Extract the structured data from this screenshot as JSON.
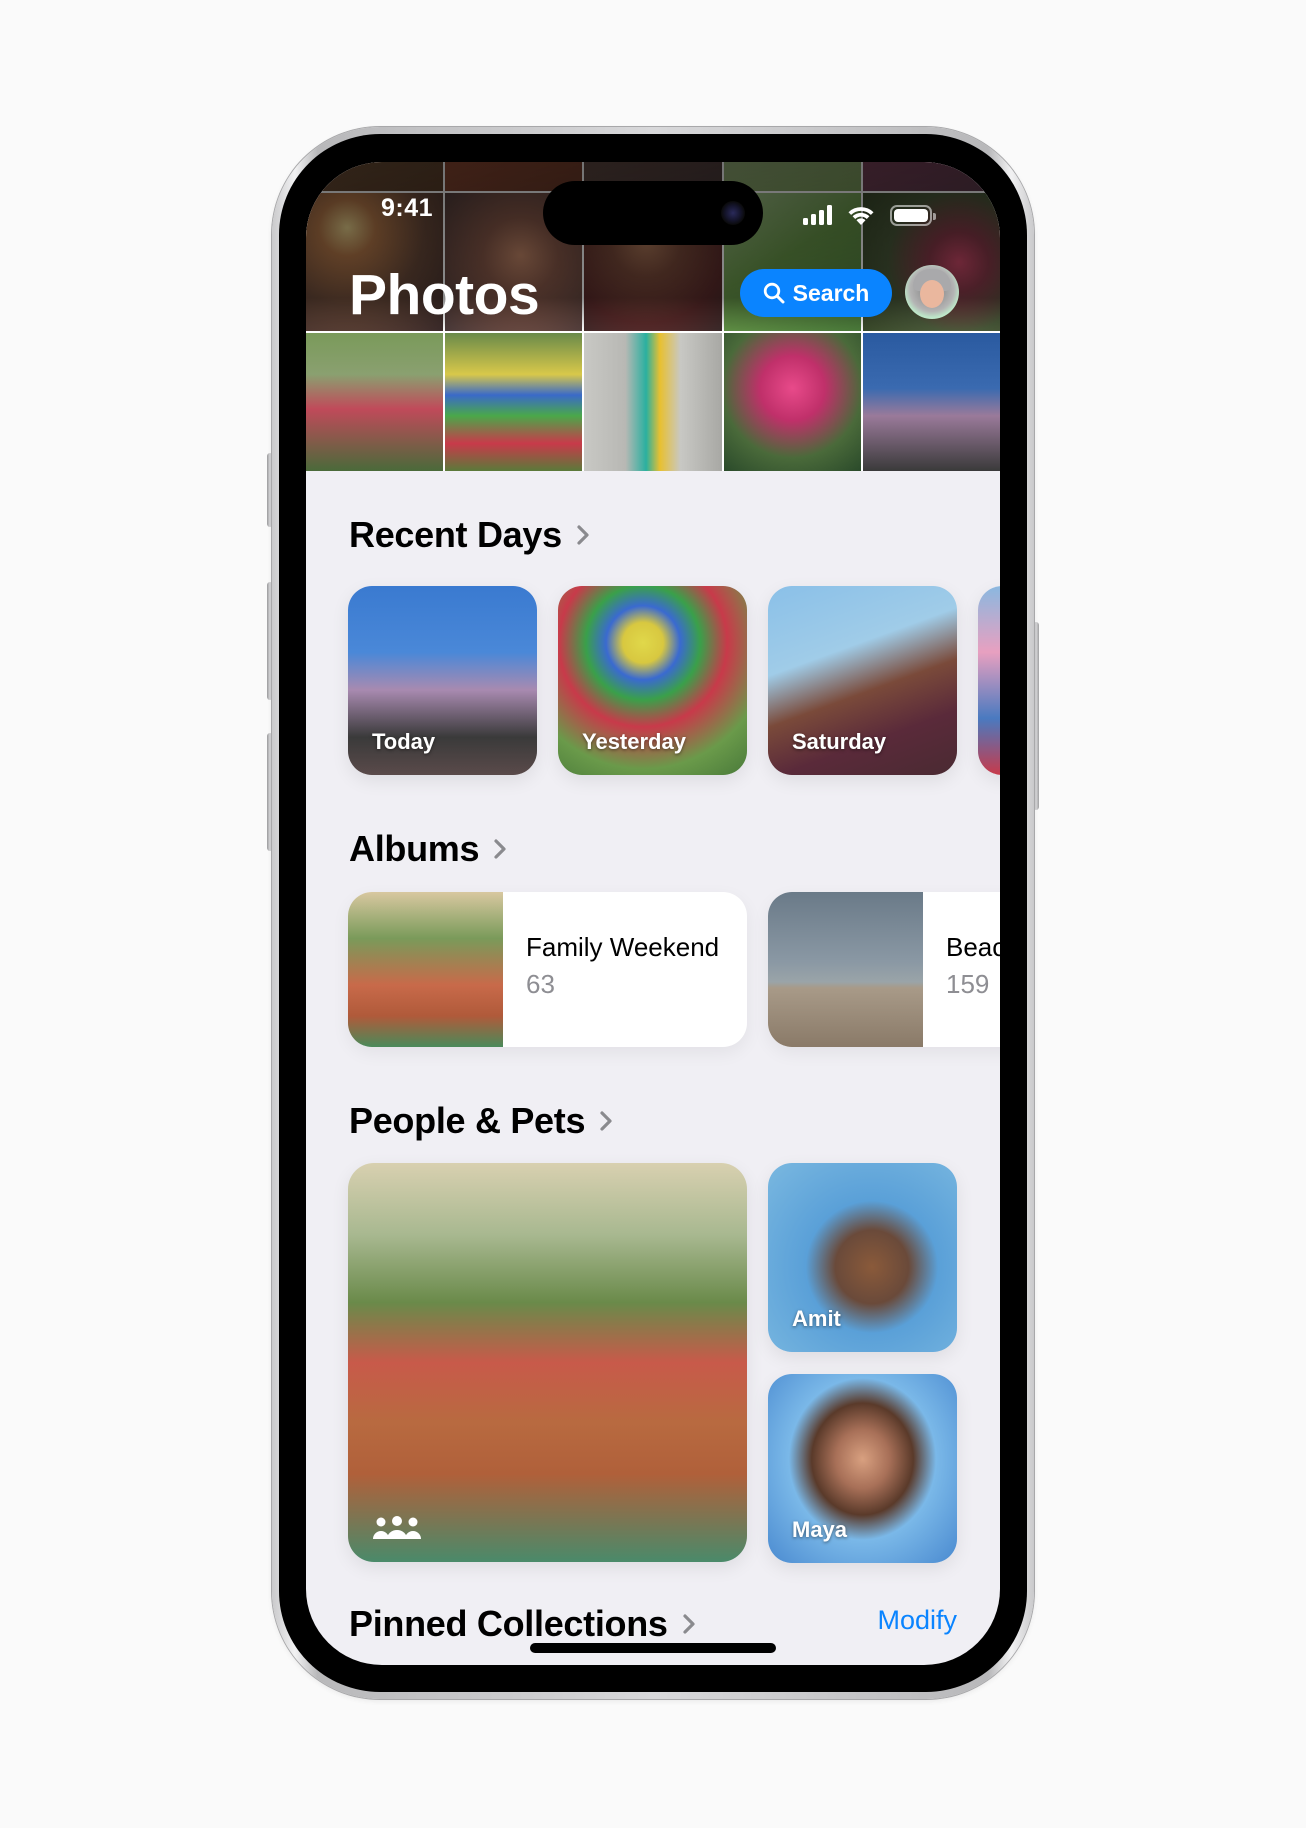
{
  "status_bar": {
    "time": "9:41",
    "icons": [
      "cellular-signal-icon",
      "wifi-icon",
      "battery-icon"
    ]
  },
  "header": {
    "title": "Photos",
    "search_label": "Search",
    "search_icon": "magnifying-glass-icon",
    "avatar": "memoji-avatar"
  },
  "colors": {
    "accent": "#0a84ff",
    "background": "#f0eff4",
    "secondary_text": "#8e8e93",
    "chevron": "#8a8a8e"
  },
  "sections": {
    "recent_days": {
      "title": "Recent Days",
      "items": [
        {
          "label": "Today"
        },
        {
          "label": "Yesterday"
        },
        {
          "label": "Saturday"
        },
        {
          "label": ""
        }
      ]
    },
    "albums": {
      "title": "Albums",
      "items": [
        {
          "name": "Family Weekend",
          "count": "63"
        },
        {
          "name": "Beac",
          "count": "159"
        }
      ]
    },
    "people_pets": {
      "title": "People & Pets",
      "group_icon": "group-people-icon",
      "people": [
        {
          "name": "Amit"
        },
        {
          "name": "Maya"
        }
      ]
    },
    "pinned_collections": {
      "title": "Pinned Collections",
      "action_label": "Modify"
    }
  }
}
